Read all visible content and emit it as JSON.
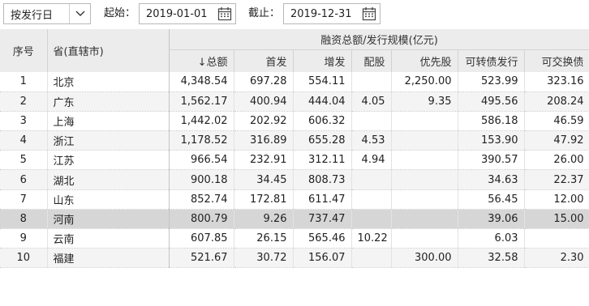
{
  "toolbar": {
    "mode_value": "按发行日",
    "start_label": "起始：",
    "start_date": "2019-01-01",
    "end_label": "截止：",
    "end_date": "2019-12-31"
  },
  "table": {
    "col_index": "序号",
    "col_region": "省(直辖市)",
    "group_title": "融资总额/发行规模(亿元)",
    "sub_headers": [
      "↓总额",
      "首发",
      "增发",
      "配股",
      "优先股",
      "可转债发行",
      "可交换债"
    ],
    "highlight_row": 8,
    "rows": [
      {
        "idx": "1",
        "region": "北京",
        "total": "4,348.54",
        "ipo": "697.28",
        "spo": "554.11",
        "rights": "",
        "preferred": "2,250.00",
        "convertible": "523.99",
        "exchangeable": "323.16"
      },
      {
        "idx": "2",
        "region": "广东",
        "total": "1,562.17",
        "ipo": "400.94",
        "spo": "444.04",
        "rights": "4.05",
        "preferred": "9.35",
        "convertible": "495.56",
        "exchangeable": "208.24"
      },
      {
        "idx": "3",
        "region": "上海",
        "total": "1,442.02",
        "ipo": "202.92",
        "spo": "606.32",
        "rights": "",
        "preferred": "",
        "convertible": "586.18",
        "exchangeable": "46.59"
      },
      {
        "idx": "4",
        "region": "浙江",
        "total": "1,178.52",
        "ipo": "316.89",
        "spo": "655.28",
        "rights": "4.53",
        "preferred": "",
        "convertible": "153.90",
        "exchangeable": "47.92"
      },
      {
        "idx": "5",
        "region": "江苏",
        "total": "966.54",
        "ipo": "232.91",
        "spo": "312.11",
        "rights": "4.94",
        "preferred": "",
        "convertible": "390.57",
        "exchangeable": "26.00"
      },
      {
        "idx": "6",
        "region": "湖北",
        "total": "900.18",
        "ipo": "34.45",
        "spo": "808.73",
        "rights": "",
        "preferred": "",
        "convertible": "34.63",
        "exchangeable": "22.37"
      },
      {
        "idx": "7",
        "region": "山东",
        "total": "852.74",
        "ipo": "172.81",
        "spo": "611.47",
        "rights": "",
        "preferred": "",
        "convertible": "56.45",
        "exchangeable": "12.00"
      },
      {
        "idx": "8",
        "region": "河南",
        "total": "800.79",
        "ipo": "9.26",
        "spo": "737.47",
        "rights": "",
        "preferred": "",
        "convertible": "39.06",
        "exchangeable": "15.00"
      },
      {
        "idx": "9",
        "region": "云南",
        "total": "607.85",
        "ipo": "26.15",
        "spo": "565.46",
        "rights": "10.22",
        "preferred": "",
        "convertible": "6.03",
        "exchangeable": ""
      },
      {
        "idx": "10",
        "region": "福建",
        "total": "521.67",
        "ipo": "30.72",
        "spo": "156.07",
        "rights": "",
        "preferred": "300.00",
        "convertible": "32.58",
        "exchangeable": "2.30"
      }
    ]
  }
}
